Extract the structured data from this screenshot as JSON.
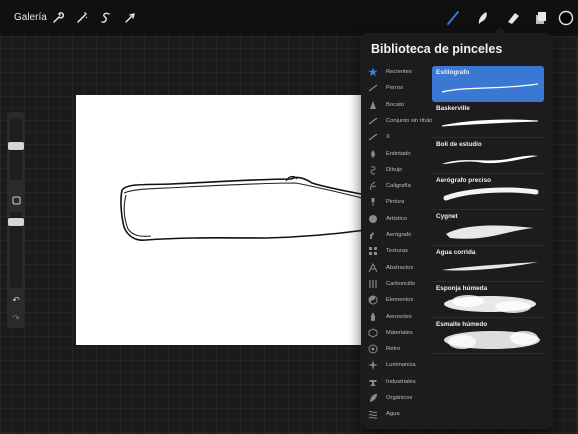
{
  "topbar": {
    "gallery_label": "Galería",
    "left_tools": [
      "wrench-icon",
      "magic-wand-icon",
      "selection-icon",
      "transform-arrow-icon"
    ],
    "right_tools": [
      "brush-icon",
      "smudge-icon",
      "eraser-icon",
      "layers-icon",
      "color-icon"
    ],
    "accent_color": "#3c7de0"
  },
  "sidebar": {
    "size_slider_level": 0.15,
    "opacity_slider_level": 0.35,
    "modify_button_icon": "square-icon",
    "undo_icon": "undo-icon",
    "redo_icon": "redo-icon"
  },
  "brush_library": {
    "title": "Biblioteca de pinceles",
    "sets": [
      {
        "label": "Recientes",
        "icon": "star-icon",
        "active": true
      },
      {
        "label": "Perros",
        "icon": "stroke-icon"
      },
      {
        "label": "Bocato",
        "icon": "cone-icon"
      },
      {
        "label": "Conjunto sin título",
        "icon": "stroke-icon"
      },
      {
        "label": "X",
        "icon": "stroke-icon"
      },
      {
        "label": "Entintado",
        "icon": "ink-drop-icon"
      },
      {
        "label": "Dibujo",
        "icon": "pencil-swirl-icon"
      },
      {
        "label": "Caligrafía",
        "icon": "calligraphy-icon"
      },
      {
        "label": "Pintura",
        "icon": "paint-brush-icon"
      },
      {
        "label": "Artístico",
        "icon": "palette-icon"
      },
      {
        "label": "Aerógrafo",
        "icon": "airbrush-icon"
      },
      {
        "label": "Texturas",
        "icon": "texture-icon"
      },
      {
        "label": "Abstractos",
        "icon": "abstract-icon"
      },
      {
        "label": "Carboncillo",
        "icon": "charcoal-icon"
      },
      {
        "label": "Elementos",
        "icon": "yin-yang-icon"
      },
      {
        "label": "Aerosoles",
        "icon": "spray-can-icon"
      },
      {
        "label": "Materiales",
        "icon": "materials-icon"
      },
      {
        "label": "Retro",
        "icon": "retro-icon"
      },
      {
        "label": "Luminancia",
        "icon": "sparkle-icon"
      },
      {
        "label": "Industriales",
        "icon": "anvil-icon"
      },
      {
        "label": "Orgánicos",
        "icon": "leaf-icon"
      },
      {
        "label": "Agua",
        "icon": "water-icon"
      }
    ],
    "brushes": [
      {
        "name": "Estilógrafo",
        "selected": true,
        "stroke": "thin-line"
      },
      {
        "name": "Baskerville",
        "stroke": "tapered"
      },
      {
        "name": "Boli de estudio",
        "stroke": "tapered-wave"
      },
      {
        "name": "Aerógrafo preciso",
        "stroke": "soft-thick"
      },
      {
        "name": "Cygnet",
        "stroke": "rough"
      },
      {
        "name": "Agua corrida",
        "stroke": "streak"
      },
      {
        "name": "Esponja húmeda",
        "stroke": "cloud"
      },
      {
        "name": "Esmalte húmedo",
        "stroke": "cloud-wide"
      }
    ]
  }
}
